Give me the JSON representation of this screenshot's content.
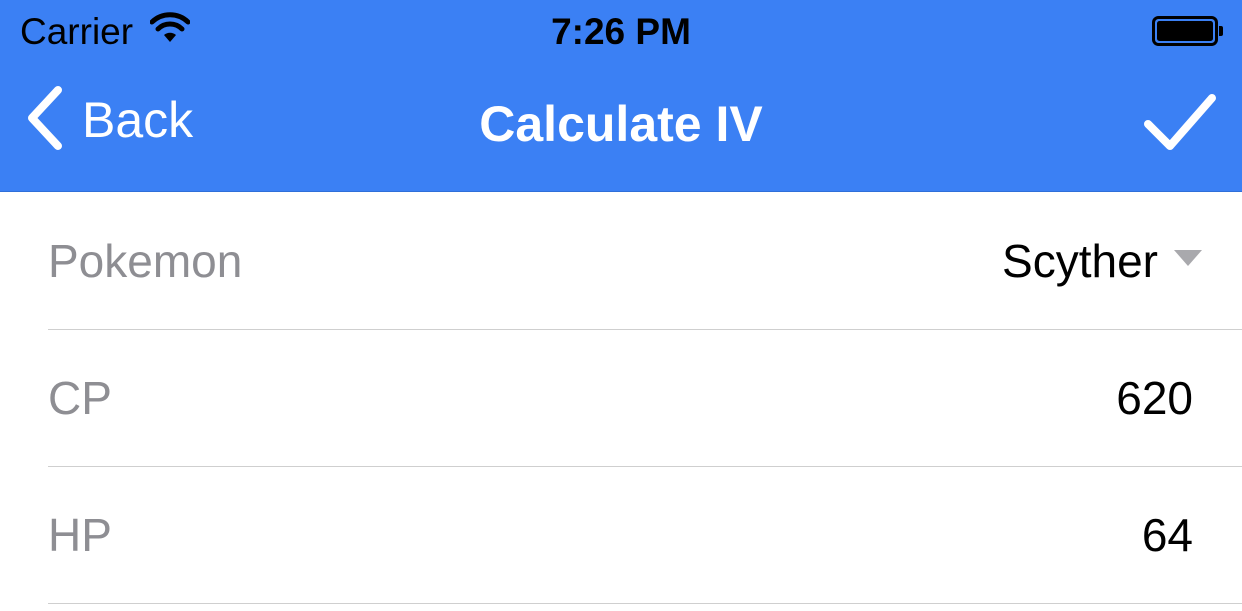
{
  "status_bar": {
    "carrier": "Carrier",
    "time": "7:26 PM",
    "icons": [
      "wifi-icon",
      "battery-icon"
    ]
  },
  "nav_bar": {
    "back_label": "Back",
    "title": "Calculate IV",
    "icons": [
      "chevron-left-icon",
      "checkmark-icon"
    ],
    "background_color": "#3b80f4",
    "foreground_color": "#ffffff"
  },
  "form": {
    "pokemon": {
      "label": "Pokemon",
      "value": "Scyther",
      "icon": "dropdown-caret-icon"
    },
    "cp": {
      "label": "CP",
      "value": "620"
    },
    "hp": {
      "label": "HP",
      "value": "64"
    },
    "label_color": "#8e8e93",
    "separator_color": "#cfcfcf"
  }
}
